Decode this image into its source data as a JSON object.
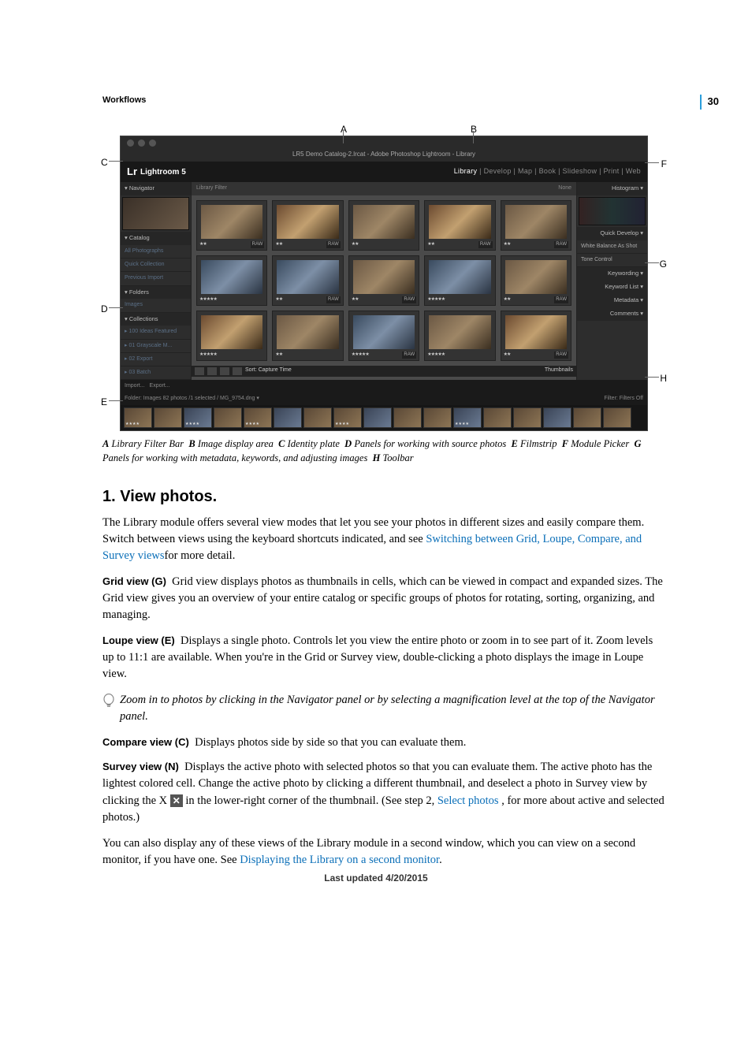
{
  "page_number": "30",
  "section_head": "Workflows",
  "callouts": {
    "A": "A",
    "B": "B",
    "C": "C",
    "D": "D",
    "E": "E",
    "F": "F",
    "G": "G",
    "H": "H"
  },
  "shot": {
    "title": "LR5 Demo Catalog-2.lrcat - Adobe Photoshop Lightroom - Library",
    "logo": "Lightroom 5",
    "logo_prefix": "Lr",
    "modules": "Library | Develop | Map | Book | Slideshow | Print | Web",
    "module_active": "Library",
    "filter_left": "Library Filter",
    "filter_right": "None",
    "left": {
      "nav": "▾ Navigator",
      "catalog": "▾ Catalog",
      "cat_all": "All Photographs",
      "cat_quick": "Quick Collection",
      "cat_prev": "Previous Import",
      "folders": "▾ Folders",
      "collections": "▾ Collections",
      "import": "Import...",
      "export": "Export..."
    },
    "right": {
      "hist": "Histogram ▾",
      "qd": "Quick Develop ▾",
      "kw": "Keywording ▾",
      "kwl": "Keyword List ▾",
      "meta": "Metadata ▾",
      "comments": "Comments ▾"
    },
    "toolbar_sort": "Sort: Capture Time",
    "thumbnails_label": "Thumbnails",
    "bottom_path": "Folder: Images  82 photos /1 selected / MG_9754.dng ▾",
    "bottom_filter": "Filter:  Filters Off"
  },
  "caption": {
    "A": "Library Filter Bar",
    "B": "Image display area",
    "C": "Identity plate",
    "D": "Panels for working with source photos",
    "E": "Filmstrip",
    "F": "Module Picker",
    "G": "Panels for working with metadata, keywords, and adjusting images",
    "H": "Toolbar"
  },
  "h2": "1. View photos.",
  "intro1": "The Library module offers several view modes that let you see your photos in different sizes and easily compare them. Switch between views using the keyboard shortcuts indicated, and see ",
  "intro_link": "Switching between Grid, Loupe, Compare, and Survey views",
  "intro2": "for more detail.",
  "grid_term": "Grid view (G)",
  "grid_text": "Grid view displays photos as thumbnails in cells, which can be viewed in compact and expanded sizes. The Grid view gives you an overview of your entire catalog or specific groups of photos for rotating, sorting, organizing, and managing.",
  "loupe_term": "Loupe view (E)",
  "loupe_text": "Displays a single photo. Controls let you view the entire photo or zoom in to see part of it. Zoom levels up to 11:1 are available. When you're in the Grid or Survey view, double-clicking a photo displays the image in Loupe view.",
  "tip": "Zoom in to photos by clicking in the Navigator panel or by selecting a magnification level at the top of the Navigator panel.",
  "compare_term": "Compare view (C)",
  "compare_text": "Displays photos side by side so that you can evaluate them.",
  "survey_term": "Survey view (N)",
  "survey_text1": "Displays the active photo with selected photos so that you can evaluate them. The active photo has the lightest colored cell. Change the active photo by clicking a different thumbnail, and deselect a photo in Survey view by clicking the X ",
  "survey_text2": " in the lower-right corner of the thumbnail. (See step 2, ",
  "survey_link": "Select photos",
  "survey_text3": " , for more about active and selected photos.)",
  "second1": "You can also display any of these views of the Library module in a second window, which you can view on a second monitor, if you have one. See ",
  "second_link": "Displaying the Library on a second monitor",
  "second2": ".",
  "footer": "Last updated 4/20/2015"
}
